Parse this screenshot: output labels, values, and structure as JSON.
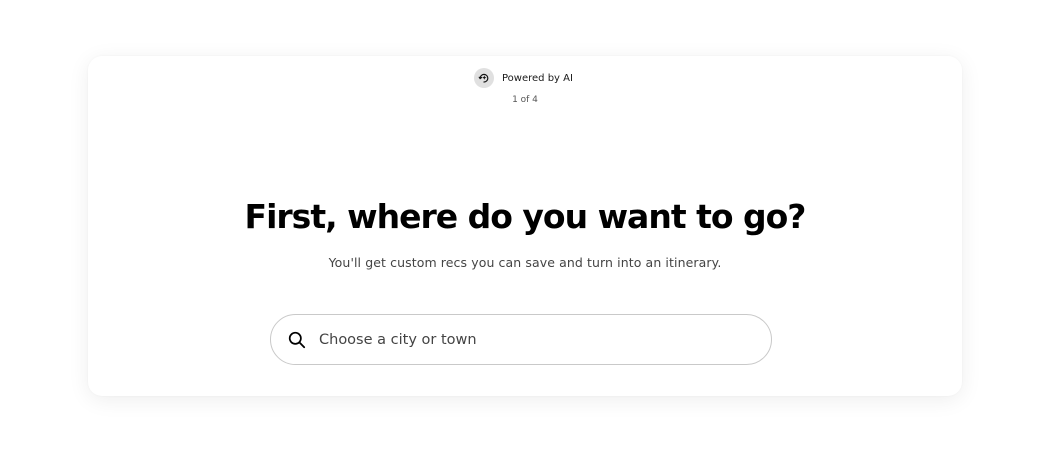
{
  "badge": {
    "icon": "ai-sparkle-pin-icon",
    "label": "Powered by AI"
  },
  "step": "1 of 4",
  "headline": "First, where do you want to go?",
  "subtitle": "You'll get custom recs you can save and turn into an itinerary.",
  "search": {
    "icon": "search-icon",
    "placeholder": "Choose a city or town",
    "value": ""
  }
}
